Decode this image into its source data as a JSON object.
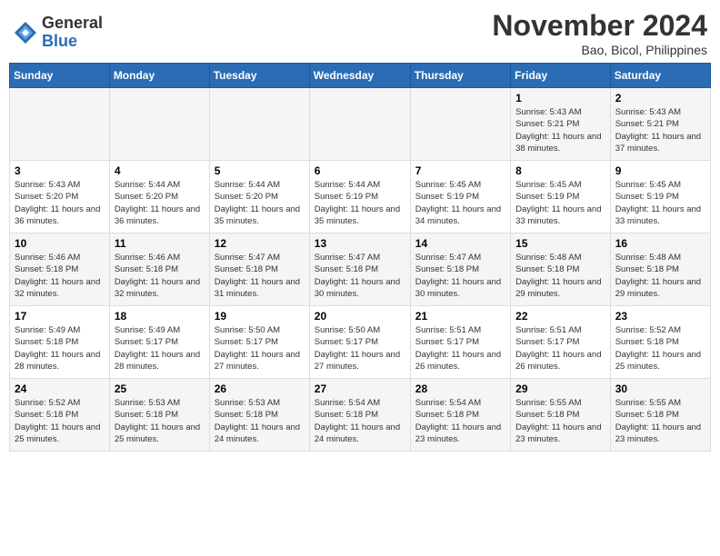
{
  "logo": {
    "general": "General",
    "blue": "Blue"
  },
  "title": {
    "month": "November 2024",
    "location": "Bao, Bicol, Philippines"
  },
  "weekdays": [
    "Sunday",
    "Monday",
    "Tuesday",
    "Wednesday",
    "Thursday",
    "Friday",
    "Saturday"
  ],
  "weeks": [
    [
      {
        "day": "",
        "sunrise": "",
        "sunset": "",
        "daylight": ""
      },
      {
        "day": "",
        "sunrise": "",
        "sunset": "",
        "daylight": ""
      },
      {
        "day": "",
        "sunrise": "",
        "sunset": "",
        "daylight": ""
      },
      {
        "day": "",
        "sunrise": "",
        "sunset": "",
        "daylight": ""
      },
      {
        "day": "",
        "sunrise": "",
        "sunset": "",
        "daylight": ""
      },
      {
        "day": "1",
        "sunrise": "Sunrise: 5:43 AM",
        "sunset": "Sunset: 5:21 PM",
        "daylight": "Daylight: 11 hours and 38 minutes."
      },
      {
        "day": "2",
        "sunrise": "Sunrise: 5:43 AM",
        "sunset": "Sunset: 5:21 PM",
        "daylight": "Daylight: 11 hours and 37 minutes."
      }
    ],
    [
      {
        "day": "3",
        "sunrise": "Sunrise: 5:43 AM",
        "sunset": "Sunset: 5:20 PM",
        "daylight": "Daylight: 11 hours and 36 minutes."
      },
      {
        "day": "4",
        "sunrise": "Sunrise: 5:44 AM",
        "sunset": "Sunset: 5:20 PM",
        "daylight": "Daylight: 11 hours and 36 minutes."
      },
      {
        "day": "5",
        "sunrise": "Sunrise: 5:44 AM",
        "sunset": "Sunset: 5:20 PM",
        "daylight": "Daylight: 11 hours and 35 minutes."
      },
      {
        "day": "6",
        "sunrise": "Sunrise: 5:44 AM",
        "sunset": "Sunset: 5:19 PM",
        "daylight": "Daylight: 11 hours and 35 minutes."
      },
      {
        "day": "7",
        "sunrise": "Sunrise: 5:45 AM",
        "sunset": "Sunset: 5:19 PM",
        "daylight": "Daylight: 11 hours and 34 minutes."
      },
      {
        "day": "8",
        "sunrise": "Sunrise: 5:45 AM",
        "sunset": "Sunset: 5:19 PM",
        "daylight": "Daylight: 11 hours and 33 minutes."
      },
      {
        "day": "9",
        "sunrise": "Sunrise: 5:45 AM",
        "sunset": "Sunset: 5:19 PM",
        "daylight": "Daylight: 11 hours and 33 minutes."
      }
    ],
    [
      {
        "day": "10",
        "sunrise": "Sunrise: 5:46 AM",
        "sunset": "Sunset: 5:18 PM",
        "daylight": "Daylight: 11 hours and 32 minutes."
      },
      {
        "day": "11",
        "sunrise": "Sunrise: 5:46 AM",
        "sunset": "Sunset: 5:18 PM",
        "daylight": "Daylight: 11 hours and 32 minutes."
      },
      {
        "day": "12",
        "sunrise": "Sunrise: 5:47 AM",
        "sunset": "Sunset: 5:18 PM",
        "daylight": "Daylight: 11 hours and 31 minutes."
      },
      {
        "day": "13",
        "sunrise": "Sunrise: 5:47 AM",
        "sunset": "Sunset: 5:18 PM",
        "daylight": "Daylight: 11 hours and 30 minutes."
      },
      {
        "day": "14",
        "sunrise": "Sunrise: 5:47 AM",
        "sunset": "Sunset: 5:18 PM",
        "daylight": "Daylight: 11 hours and 30 minutes."
      },
      {
        "day": "15",
        "sunrise": "Sunrise: 5:48 AM",
        "sunset": "Sunset: 5:18 PM",
        "daylight": "Daylight: 11 hours and 29 minutes."
      },
      {
        "day": "16",
        "sunrise": "Sunrise: 5:48 AM",
        "sunset": "Sunset: 5:18 PM",
        "daylight": "Daylight: 11 hours and 29 minutes."
      }
    ],
    [
      {
        "day": "17",
        "sunrise": "Sunrise: 5:49 AM",
        "sunset": "Sunset: 5:18 PM",
        "daylight": "Daylight: 11 hours and 28 minutes."
      },
      {
        "day": "18",
        "sunrise": "Sunrise: 5:49 AM",
        "sunset": "Sunset: 5:17 PM",
        "daylight": "Daylight: 11 hours and 28 minutes."
      },
      {
        "day": "19",
        "sunrise": "Sunrise: 5:50 AM",
        "sunset": "Sunset: 5:17 PM",
        "daylight": "Daylight: 11 hours and 27 minutes."
      },
      {
        "day": "20",
        "sunrise": "Sunrise: 5:50 AM",
        "sunset": "Sunset: 5:17 PM",
        "daylight": "Daylight: 11 hours and 27 minutes."
      },
      {
        "day": "21",
        "sunrise": "Sunrise: 5:51 AM",
        "sunset": "Sunset: 5:17 PM",
        "daylight": "Daylight: 11 hours and 26 minutes."
      },
      {
        "day": "22",
        "sunrise": "Sunrise: 5:51 AM",
        "sunset": "Sunset: 5:17 PM",
        "daylight": "Daylight: 11 hours and 26 minutes."
      },
      {
        "day": "23",
        "sunrise": "Sunrise: 5:52 AM",
        "sunset": "Sunset: 5:18 PM",
        "daylight": "Daylight: 11 hours and 25 minutes."
      }
    ],
    [
      {
        "day": "24",
        "sunrise": "Sunrise: 5:52 AM",
        "sunset": "Sunset: 5:18 PM",
        "daylight": "Daylight: 11 hours and 25 minutes."
      },
      {
        "day": "25",
        "sunrise": "Sunrise: 5:53 AM",
        "sunset": "Sunset: 5:18 PM",
        "daylight": "Daylight: 11 hours and 25 minutes."
      },
      {
        "day": "26",
        "sunrise": "Sunrise: 5:53 AM",
        "sunset": "Sunset: 5:18 PM",
        "daylight": "Daylight: 11 hours and 24 minutes."
      },
      {
        "day": "27",
        "sunrise": "Sunrise: 5:54 AM",
        "sunset": "Sunset: 5:18 PM",
        "daylight": "Daylight: 11 hours and 24 minutes."
      },
      {
        "day": "28",
        "sunrise": "Sunrise: 5:54 AM",
        "sunset": "Sunset: 5:18 PM",
        "daylight": "Daylight: 11 hours and 23 minutes."
      },
      {
        "day": "29",
        "sunrise": "Sunrise: 5:55 AM",
        "sunset": "Sunset: 5:18 PM",
        "daylight": "Daylight: 11 hours and 23 minutes."
      },
      {
        "day": "30",
        "sunrise": "Sunrise: 5:55 AM",
        "sunset": "Sunset: 5:18 PM",
        "daylight": "Daylight: 11 hours and 23 minutes."
      }
    ]
  ]
}
